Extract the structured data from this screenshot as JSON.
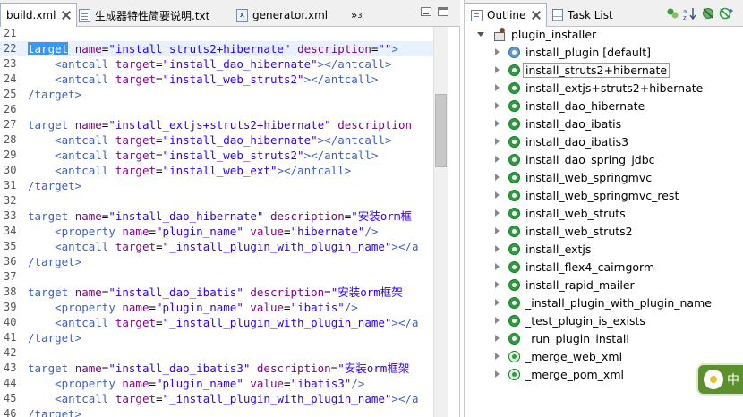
{
  "editor": {
    "tabs": [
      {
        "label": "build.xml",
        "active": true
      },
      {
        "label": "生成器特性简要说明.txt"
      },
      {
        "label": "generator.xml"
      }
    ],
    "overflow_chevron": "»",
    "overflow_count": "3",
    "lines": [
      {
        "n": "21",
        "parts": []
      },
      {
        "n": "22",
        "hl": true,
        "parts": [
          [
            "tag sel",
            "target"
          ],
          [
            "txt",
            " "
          ],
          [
            "attr",
            "name"
          ],
          [
            "txt",
            "="
          ],
          [
            "val",
            "\"install_struts2+hibernate\""
          ],
          [
            "txt",
            " "
          ],
          [
            "attr",
            "description"
          ],
          [
            "txt",
            "="
          ],
          [
            "val",
            "\"\""
          ],
          [
            "tag",
            ">"
          ]
        ]
      },
      {
        "n": "23",
        "parts": [
          [
            "txt",
            "    "
          ],
          [
            "tag",
            "<antcall"
          ],
          [
            "txt",
            " "
          ],
          [
            "attr",
            "target"
          ],
          [
            "txt",
            "="
          ],
          [
            "val",
            "\"install_dao_hibernate\""
          ],
          [
            "tag",
            "></antcall>"
          ]
        ]
      },
      {
        "n": "24",
        "parts": [
          [
            "txt",
            "    "
          ],
          [
            "tag",
            "<antcall"
          ],
          [
            "txt",
            " "
          ],
          [
            "attr",
            "target"
          ],
          [
            "txt",
            "="
          ],
          [
            "val",
            "\"install_web_struts2\""
          ],
          [
            "tag",
            "></antcall>"
          ]
        ]
      },
      {
        "n": "25",
        "parts": [
          [
            "tag",
            "/target>"
          ]
        ]
      },
      {
        "n": "26",
        "parts": []
      },
      {
        "n": "27",
        "parts": [
          [
            "tag",
            "target"
          ],
          [
            "txt",
            " "
          ],
          [
            "attr",
            "name"
          ],
          [
            "txt",
            "="
          ],
          [
            "val",
            "\"install_extjs+struts2+hibernate\""
          ],
          [
            "txt",
            " "
          ],
          [
            "attr",
            "description"
          ]
        ]
      },
      {
        "n": "28",
        "parts": [
          [
            "txt",
            "    "
          ],
          [
            "tag",
            "<antcall"
          ],
          [
            "txt",
            " "
          ],
          [
            "attr",
            "target"
          ],
          [
            "txt",
            "="
          ],
          [
            "val",
            "\"install_dao_hibernate\""
          ],
          [
            "tag",
            "></antcall>"
          ]
        ]
      },
      {
        "n": "29",
        "parts": [
          [
            "txt",
            "    "
          ],
          [
            "tag",
            "<antcall"
          ],
          [
            "txt",
            " "
          ],
          [
            "attr",
            "target"
          ],
          [
            "txt",
            "="
          ],
          [
            "val",
            "\"install_web_struts2\""
          ],
          [
            "tag",
            "></antcall>"
          ]
        ]
      },
      {
        "n": "30",
        "parts": [
          [
            "txt",
            "    "
          ],
          [
            "tag",
            "<antcall"
          ],
          [
            "txt",
            " "
          ],
          [
            "attr",
            "target"
          ],
          [
            "txt",
            "="
          ],
          [
            "val",
            "\"install_web_ext\""
          ],
          [
            "tag",
            "></antcall>"
          ]
        ]
      },
      {
        "n": "31",
        "parts": [
          [
            "tag",
            "/target>"
          ]
        ]
      },
      {
        "n": "32",
        "parts": []
      },
      {
        "n": "33",
        "parts": [
          [
            "tag",
            "target"
          ],
          [
            "txt",
            " "
          ],
          [
            "attr",
            "name"
          ],
          [
            "txt",
            "="
          ],
          [
            "val",
            "\"install_dao_hibernate\""
          ],
          [
            "txt",
            " "
          ],
          [
            "attr",
            "description"
          ],
          [
            "txt",
            "="
          ],
          [
            "val",
            "\"安装orm框"
          ]
        ]
      },
      {
        "n": "34",
        "parts": [
          [
            "txt",
            "    "
          ],
          [
            "tag",
            "<property"
          ],
          [
            "txt",
            " "
          ],
          [
            "attr",
            "name"
          ],
          [
            "txt",
            "="
          ],
          [
            "val",
            "\"plugin_name\""
          ],
          [
            "txt",
            " "
          ],
          [
            "attr",
            "value"
          ],
          [
            "txt",
            "="
          ],
          [
            "val",
            "\"hibernate\""
          ],
          [
            "tag",
            "/>"
          ]
        ]
      },
      {
        "n": "35",
        "parts": [
          [
            "txt",
            "    "
          ],
          [
            "tag",
            "<antcall"
          ],
          [
            "txt",
            " "
          ],
          [
            "attr",
            "target"
          ],
          [
            "txt",
            "="
          ],
          [
            "val",
            "\"_install_plugin_with_plugin_name\""
          ],
          [
            "tag",
            "></a"
          ]
        ]
      },
      {
        "n": "36",
        "parts": [
          [
            "tag",
            "/target>"
          ]
        ]
      },
      {
        "n": "37",
        "parts": []
      },
      {
        "n": "38",
        "parts": [
          [
            "tag",
            "target"
          ],
          [
            "txt",
            " "
          ],
          [
            "attr",
            "name"
          ],
          [
            "txt",
            "="
          ],
          [
            "val",
            "\"install_dao_ibatis\""
          ],
          [
            "txt",
            " "
          ],
          [
            "attr",
            "description"
          ],
          [
            "txt",
            "="
          ],
          [
            "val",
            "\"安装orm框架"
          ]
        ]
      },
      {
        "n": "39",
        "parts": [
          [
            "txt",
            "    "
          ],
          [
            "tag",
            "<property"
          ],
          [
            "txt",
            " "
          ],
          [
            "attr",
            "name"
          ],
          [
            "txt",
            "="
          ],
          [
            "val",
            "\"plugin_name\""
          ],
          [
            "txt",
            " "
          ],
          [
            "attr",
            "value"
          ],
          [
            "txt",
            "="
          ],
          [
            "val",
            "\"ibatis\""
          ],
          [
            "tag",
            "/>"
          ]
        ]
      },
      {
        "n": "40",
        "parts": [
          [
            "txt",
            "    "
          ],
          [
            "tag",
            "<antcall"
          ],
          [
            "txt",
            " "
          ],
          [
            "attr",
            "target"
          ],
          [
            "txt",
            "="
          ],
          [
            "val",
            "\"_install_plugin_with_plugin_name\""
          ],
          [
            "tag",
            "></a"
          ]
        ]
      },
      {
        "n": "41",
        "parts": [
          [
            "tag",
            "/target>"
          ]
        ]
      },
      {
        "n": "42",
        "parts": []
      },
      {
        "n": "43",
        "parts": [
          [
            "tag",
            "target"
          ],
          [
            "txt",
            " "
          ],
          [
            "attr",
            "name"
          ],
          [
            "txt",
            "="
          ],
          [
            "val",
            "\"install_dao_ibatis3\""
          ],
          [
            "txt",
            " "
          ],
          [
            "attr",
            "description"
          ],
          [
            "txt",
            "="
          ],
          [
            "val",
            "\"安装orm框架"
          ]
        ]
      },
      {
        "n": "44",
        "parts": [
          [
            "txt",
            "    "
          ],
          [
            "tag",
            "<property"
          ],
          [
            "txt",
            " "
          ],
          [
            "attr",
            "name"
          ],
          [
            "txt",
            "="
          ],
          [
            "val",
            "\"plugin_name\""
          ],
          [
            "txt",
            " "
          ],
          [
            "attr",
            "value"
          ],
          [
            "txt",
            "="
          ],
          [
            "val",
            "\"ibatis3\""
          ],
          [
            "tag",
            "/>"
          ]
        ]
      },
      {
        "n": "45",
        "parts": [
          [
            "txt",
            "    "
          ],
          [
            "tag",
            "<antcall"
          ],
          [
            "txt",
            " "
          ],
          [
            "attr",
            "target"
          ],
          [
            "txt",
            "="
          ],
          [
            "val",
            "\"_install_plugin_with_plugin_name\""
          ],
          [
            "tag",
            "></a"
          ]
        ]
      },
      {
        "n": "46",
        "parts": [
          [
            "tag",
            "/target>"
          ]
        ]
      }
    ]
  },
  "outline": {
    "tabs": [
      {
        "label": "Outline",
        "active": true
      },
      {
        "label": "Task List"
      }
    ],
    "root": "plugin_installer",
    "items": [
      {
        "label": "install_plugin [default]",
        "icon": "default"
      },
      {
        "label": "install_struts2+hibernate",
        "icon": "public",
        "selected": true
      },
      {
        "label": "install_extjs+struts2+hibernate",
        "icon": "public"
      },
      {
        "label": "install_dao_hibernate",
        "icon": "public"
      },
      {
        "label": "install_dao_ibatis",
        "icon": "public"
      },
      {
        "label": "install_dao_ibatis3",
        "icon": "public"
      },
      {
        "label": "install_dao_spring_jdbc",
        "icon": "public"
      },
      {
        "label": "install_web_springmvc",
        "icon": "public"
      },
      {
        "label": "install_web_springmvc_rest",
        "icon": "public"
      },
      {
        "label": "install_web_struts",
        "icon": "public"
      },
      {
        "label": "install_web_struts2",
        "icon": "public"
      },
      {
        "label": "install_extjs",
        "icon": "public"
      },
      {
        "label": "install_flex4_cairngorm",
        "icon": "public"
      },
      {
        "label": "install_rapid_mailer",
        "icon": "public"
      },
      {
        "label": "_install_plugin_with_plugin_name",
        "icon": "public"
      },
      {
        "label": "_test_plugin_is_exists",
        "icon": "public"
      },
      {
        "label": "_run_plugin_install",
        "icon": "public"
      },
      {
        "label": "_merge_web_xml",
        "icon": "private"
      },
      {
        "label": "_merge_pom_xml",
        "icon": "private"
      }
    ]
  },
  "badge": {
    "text": "中"
  },
  "colors": {
    "tag": "#3f5fbf",
    "attr": "#7f007f",
    "value": "#2a00ff",
    "target_icon": "#2c9e3f",
    "selection": "#3399ff"
  }
}
